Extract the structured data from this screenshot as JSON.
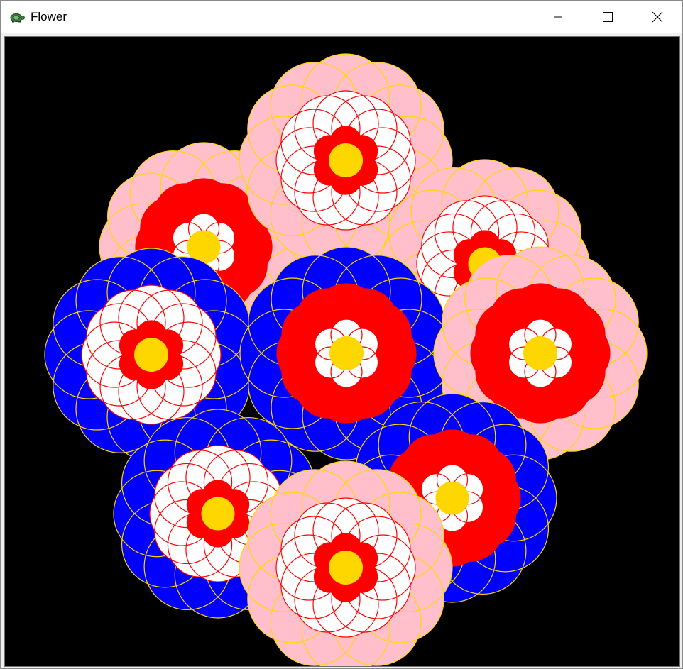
{
  "window": {
    "title": "Flower",
    "icon": "turtle-icon",
    "controls": [
      "minimize-icon",
      "maximize-icon",
      "close-icon"
    ]
  },
  "canvas": {
    "background": "#000000",
    "flowers": [
      {
        "rings": [
          "pink",
          "red",
          "white",
          "yellow"
        ]
      },
      {
        "rings": [
          "pink",
          "white",
          "red",
          "yellow"
        ]
      },
      {
        "rings": [
          "pink",
          "white",
          "red",
          "yellow"
        ]
      },
      {
        "rings": [
          "blue",
          "white",
          "red",
          "yellow"
        ]
      },
      {
        "rings": [
          "blue",
          "red",
          "white",
          "yellow"
        ]
      },
      {
        "rings": [
          "pink",
          "red",
          "white",
          "yellow"
        ]
      },
      {
        "rings": [
          "blue",
          "white",
          "red",
          "yellow"
        ]
      },
      {
        "rings": [
          "blue",
          "red",
          "white",
          "yellow"
        ]
      },
      {
        "rings": [
          "pink",
          "white",
          "red",
          "yellow"
        ]
      }
    ]
  },
  "colors": {
    "pink": "#ffc0cb",
    "red": "#ff0000",
    "white": "#ffffff",
    "blue": "#0000ff",
    "yellow": "#ffd700",
    "outline_yellow": "#ffd700",
    "outline_red": "#ff0000"
  }
}
